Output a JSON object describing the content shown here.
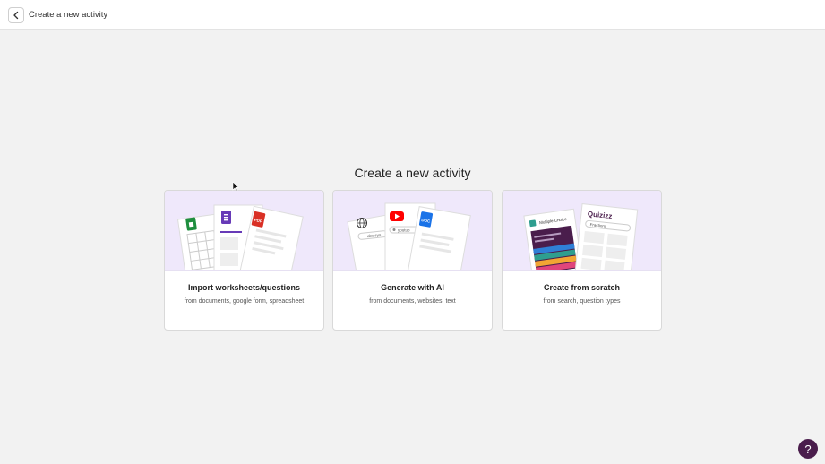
{
  "header": {
    "title": "Create a new activity",
    "back_icon": "chevron-left-icon"
  },
  "main": {
    "heading": "Create a new activity",
    "cards": [
      {
        "title": "Import worksheets/questions",
        "subtitle": "from documents, google form, spreadsheet",
        "icons": [
          "sheets-icon",
          "forms-icon",
          "pdf-icon"
        ],
        "badge_text": "PDF"
      },
      {
        "title": "Generate with AI",
        "subtitle": "from documents, websites, text",
        "icons": [
          "globe-icon",
          "youtube-icon",
          "doc-icon"
        ],
        "snippet_1": "abc.sys",
        "snippet_2": "youtub",
        "badge_text": "DOC"
      },
      {
        "title": "Create from scratch",
        "subtitle": "from search, question types",
        "label_1": "Multiple Choice",
        "brand": "Quizizz",
        "search_text": "Fractions"
      }
    ]
  },
  "help": {
    "label": "?"
  },
  "colors": {
    "art_bg": "#efe8fb",
    "brand_purple": "#4a1d4c",
    "sheets_green": "#1e8e3e",
    "forms_purple": "#673ab7",
    "pdf_red": "#d93025",
    "youtube_red": "#ff0000",
    "doc_blue": "#1a73e8"
  }
}
